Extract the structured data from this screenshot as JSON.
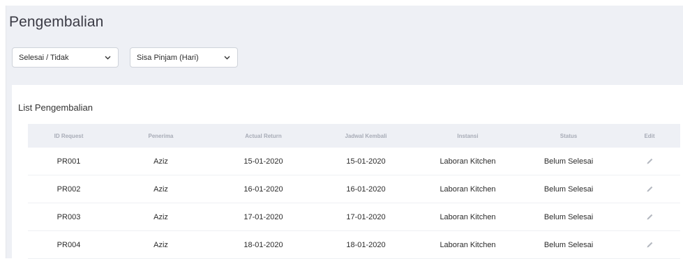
{
  "page": {
    "title": "Pengembalian"
  },
  "filters": {
    "status": {
      "selected": "Selesai / Tidak"
    },
    "sisa_pinjam": {
      "selected": "Sisa Pinjam (Hari)"
    }
  },
  "card": {
    "title": "List Pengembalian"
  },
  "table": {
    "headers": [
      "ID Request",
      "Penerima",
      "Actual Return",
      "Jadwal Kembali",
      "Instansi",
      "Status",
      "Edit"
    ],
    "rows": [
      {
        "id": "PR001",
        "penerima": "Aziz",
        "actual_return": "15-01-2020",
        "jadwal_kembali": "15-01-2020",
        "instansi": "Laboran Kitchen",
        "status": "Belum Selesai"
      },
      {
        "id": "PR002",
        "penerima": "Aziz",
        "actual_return": "16-01-2020",
        "jadwal_kembali": "16-01-2020",
        "instansi": "Laboran Kitchen",
        "status": "Belum Selesai"
      },
      {
        "id": "PR003",
        "penerima": "Aziz",
        "actual_return": "17-01-2020",
        "jadwal_kembali": "17-01-2020",
        "instansi": "Laboran Kitchen",
        "status": "Belum Selesai"
      },
      {
        "id": "PR004",
        "penerima": "Aziz",
        "actual_return": "18-01-2020",
        "jadwal_kembali": "18-01-2020",
        "instansi": "Laboran Kitchen",
        "status": "Belum Selesai"
      }
    ]
  },
  "icons": {
    "select_arrow": "chevron-down-icon",
    "edit": "pencil-icon"
  },
  "colors": {
    "page_bg": "#eef0f5",
    "header_text": "#a7abb6",
    "icon": "#b4b8c0"
  }
}
